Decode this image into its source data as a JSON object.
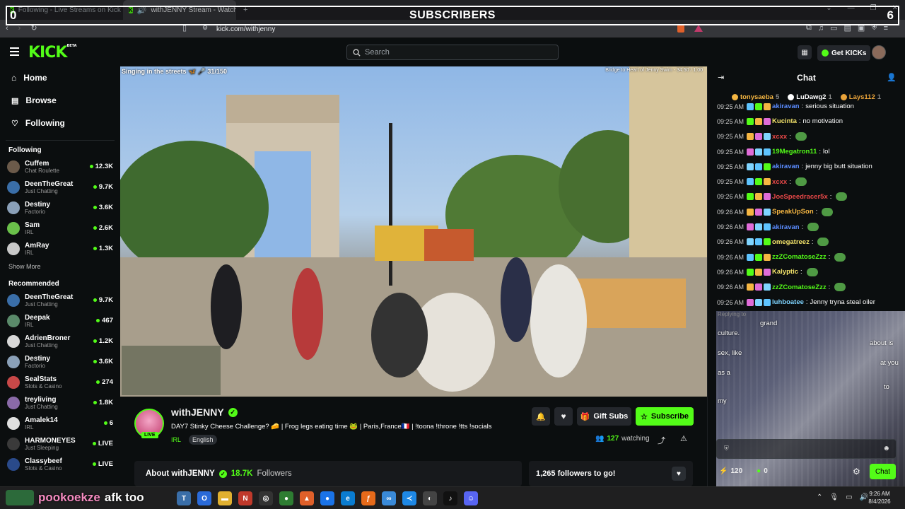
{
  "browser": {
    "tabs": [
      {
        "title": "Following - Live Streams on Kick",
        "active": false
      },
      {
        "title": "withJENNY Stream - Watch Li",
        "active": true
      }
    ],
    "new_tab": "+",
    "url": "kick.com/withjenny"
  },
  "overlay": {
    "title": "SUBSCRIBERS",
    "left_count": "0",
    "right_count": "6"
  },
  "header": {
    "logo": "KICK",
    "logo_badge": "BETA",
    "search_placeholder": "Search",
    "get_kicks": "Get KICKs"
  },
  "sidebar": {
    "nav": [
      {
        "label": "Home",
        "icon": "home-icon"
      },
      {
        "label": "Browse",
        "icon": "browse-icon"
      },
      {
        "label": "Following",
        "icon": "heart-icon"
      }
    ],
    "following_title": "Following",
    "following": [
      {
        "name": "Cuffem",
        "category": "Chat Roulette",
        "viewers": "12.3K",
        "color": "#6b5a4a"
      },
      {
        "name": "DeenTheGreat",
        "category": "Just Chatting",
        "viewers": "9.7K",
        "color": "#3a6ea8"
      },
      {
        "name": "Destiny",
        "category": "Factorio",
        "viewers": "3.6K",
        "color": "#8aa0b8"
      },
      {
        "name": "Sam",
        "category": "IRL",
        "viewers": "2.6K",
        "color": "#6ac04a"
      },
      {
        "name": "AmRay",
        "category": "IRL",
        "viewers": "1.3K",
        "color": "#c8c8c8"
      }
    ],
    "show_more": "Show More",
    "recommended_title": "Recommended",
    "recommended": [
      {
        "name": "DeenTheGreat",
        "category": "Just Chatting",
        "viewers": "9.7K",
        "color": "#3a6ea8"
      },
      {
        "name": "Deepak",
        "category": "IRL",
        "viewers": "467",
        "color": "#5a8a6a"
      },
      {
        "name": "AdrienBroner",
        "category": "Just Chatting",
        "viewers": "1.2K",
        "color": "#d8d8d8"
      },
      {
        "name": "Destiny",
        "category": "Factorio",
        "viewers": "3.6K",
        "color": "#8aa0b8"
      },
      {
        "name": "SealStats",
        "category": "Slots & Casino",
        "viewers": "274",
        "color": "#c84848"
      },
      {
        "name": "treyliving",
        "category": "Just Chatting",
        "viewers": "1.8K",
        "color": "#8a6aa8"
      },
      {
        "name": "Amalek14",
        "category": "IRL",
        "viewers": "6",
        "color": "#e0e0e0"
      },
      {
        "name": "HARMONEYES",
        "category": "Just Sleeping",
        "viewers": "LIVE",
        "color": "#3a3a3a"
      },
      {
        "name": "Classybeef",
        "category": "Slots & Casino",
        "viewers": "LIVE",
        "color": "#2a4a8a"
      }
    ]
  },
  "video": {
    "overlay_title": "Singing in the streets 🦋 🎤 31/150",
    "overlay_right": "Bridge to Heart of Jenny Swim - 34:50 / 1:00"
  },
  "stream": {
    "name": "withJENNY",
    "live": "LIVE",
    "title": "DAY7 Stinky Cheese Challenge? 🧀 | Frog legs eating time 🐸 | Paris,France🇫🇷 | !toona !throne !tts !socials",
    "tags": [
      "IRL",
      "English"
    ],
    "viewers": "127",
    "watching": "watching",
    "gift_subs": "Gift Subs",
    "subscribe": "Subscribe",
    "about": "About withJENNY",
    "followers_count": "18.7K",
    "followers_label": "Followers",
    "goal": "1,265 followers to go!"
  },
  "chat": {
    "title": "Chat",
    "top_gifters": [
      {
        "name": "tonysaeba",
        "count": "5",
        "color": "#f5b642"
      },
      {
        "name": "LuDawg2",
        "count": "1",
        "color": "#ffffff"
      },
      {
        "name": "Lays112",
        "count": "1",
        "color": "#e9a33a"
      }
    ],
    "messages": [
      {
        "time": "09:25 AM",
        "user": "akiravan",
        "text": "serious situation",
        "color": "#5b8cff"
      },
      {
        "time": "09:25 AM",
        "user": "Kucinta",
        "text": "no motivation",
        "color": "#f3e36a"
      },
      {
        "time": "09:25 AM",
        "user": "xcxx",
        "text": "",
        "color": "#e84848",
        "emote": true
      },
      {
        "time": "09:25 AM",
        "user": "19Megatron11",
        "text": "lol",
        "color": "#53fc18"
      },
      {
        "time": "09:25 AM",
        "user": "akiravan",
        "text": "jenny big butt situation",
        "color": "#5b8cff"
      },
      {
        "time": "09:25 AM",
        "user": "xcxx",
        "text": "",
        "color": "#e84848",
        "emote": true
      },
      {
        "time": "09:26 AM",
        "user": "JoeSpeedracer5x",
        "text": "",
        "color": "#e84848",
        "emote": true
      },
      {
        "time": "09:26 AM",
        "user": "SpeakUpSon",
        "text": "",
        "color": "#f5b642",
        "emote": true
      },
      {
        "time": "09:26 AM",
        "user": "akiravan",
        "text": "",
        "color": "#5b8cff",
        "emote": true
      },
      {
        "time": "09:26 AM",
        "user": "omegatreez",
        "text": "",
        "color": "#f3e36a",
        "emote": true
      },
      {
        "time": "09:26 AM",
        "user": "zzZComatoseZzz",
        "text": "",
        "color": "#53fc18",
        "emote": true
      },
      {
        "time": "09:26 AM",
        "user": "Kalyptic",
        "text": "",
        "color": "#f3e36a",
        "emote": true
      },
      {
        "time": "09:26 AM",
        "user": "zzZComatoseZzz",
        "text": "",
        "color": "#53fc18",
        "emote": true
      },
      {
        "time": "09:26 AM",
        "user": "luhboatee",
        "text": "Jenny tryna steal oiler",
        "color": "#7fd4ff"
      }
    ],
    "reply_fragment": "Replying to",
    "partial_lines": [
      "grand",
      "culture.",
      "about is",
      "sex, like",
      "at you",
      "as a",
      "to",
      "my"
    ],
    "footer_count_a": "120",
    "footer_count_b": "0",
    "send": "Chat"
  },
  "taskbar": {
    "overlay_user": "pookoekze",
    "overlay_msg": "afk too",
    "time": "9:26 AM",
    "date": "8/4/2026"
  },
  "colors": {
    "accent": "#53fc18",
    "bg": "#0b0e0f"
  }
}
